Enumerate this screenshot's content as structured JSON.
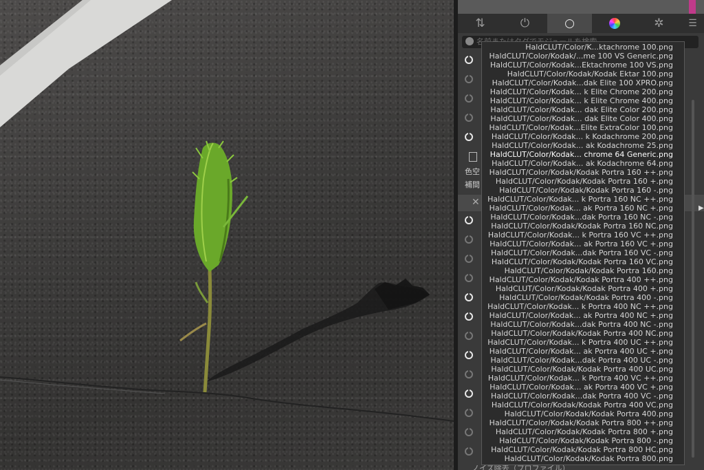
{
  "tabs": [
    {
      "name": "sliders-icon",
      "glyph": "⇅"
    },
    {
      "name": "power-icon",
      "glyph": "⏻"
    },
    {
      "name": "circle-icon",
      "glyph": "○"
    },
    {
      "name": "color-wheel-icon",
      "glyph": "●"
    },
    {
      "name": "presets-icon",
      "glyph": "✲"
    }
  ],
  "tab_menu_glyph": "☰",
  "search": {
    "placeholder": "名前またはタグでモジュールを検索"
  },
  "side_labels": [
    "色空",
    "補間"
  ],
  "bottom_text": "ノイズ除去（プロファイル）",
  "colors": {
    "panel_bg": "#3a3a3a",
    "dropdown_bg": "#2c2c2c",
    "selected_text": "#ffffff"
  },
  "lut_list": [
    "HaldCLUT/Color/K...ktachrome 100.png",
    "HaldCLUT/Color/Kodak/...me 100 VS Generic.png",
    "HaldCLUT/Color/Kodak...Ektachrome 100 VS.png",
    "HaldCLUT/Color/Kodak/Kodak Ektar 100.png",
    "HaldCLUT/Color/Kodak...dak Elite 100 XPRO.png",
    "HaldCLUT/Color/Kodak... k Elite Chrome 200.png",
    "HaldCLUT/Color/Kodak... k Elite Chrome 400.png",
    "HaldCLUT/Color/Kodak... dak Elite Color 200.png",
    "HaldCLUT/Color/Kodak... dak Elite Color 400.png",
    "HaldCLUT/Color/Kodak...Elite ExtraColor 100.png",
    "HaldCLUT/Color/Kodak... k Kodachrome 200.png",
    "HaldCLUT/Color/Kodak... ak Kodachrome 25.png",
    "HaldCLUT/Color/Kodak... chrome 64 Generic.png",
    "HaldCLUT/Color/Kodak... ak Kodachrome 64.png",
    "HaldCLUT/Color/Kodak/Kodak Portra 160 ++.png",
    "HaldCLUT/Color/Kodak/Kodak Portra 160 +.png",
    "HaldCLUT/Color/Kodak/Kodak Portra 160 -.png",
    "HaldCLUT/Color/Kodak... k Portra 160 NC ++.png",
    "HaldCLUT/Color/Kodak... ak Portra 160 NC +.png",
    "HaldCLUT/Color/Kodak...dak Portra 160 NC -.png",
    "HaldCLUT/Color/Kodak/Kodak Portra 160 NC.png",
    "HaldCLUT/Color/Kodak... k Portra 160 VC ++.png",
    "HaldCLUT/Color/Kodak... ak Portra 160 VC +.png",
    "HaldCLUT/Color/Kodak...dak Portra 160 VC -.png",
    "HaldCLUT/Color/Kodak/Kodak Portra 160 VC.png",
    "HaldCLUT/Color/Kodak/Kodak Portra 160.png",
    "HaldCLUT/Color/Kodak/Kodak Portra 400 ++.png",
    "HaldCLUT/Color/Kodak/Kodak Portra 400 +.png",
    "HaldCLUT/Color/Kodak/Kodak Portra 400 -.png",
    "HaldCLUT/Color/Kodak... k Portra 400 NC ++.png",
    "HaldCLUT/Color/Kodak... ak Portra 400 NC +.png",
    "HaldCLUT/Color/Kodak...dak Portra 400 NC -.png",
    "HaldCLUT/Color/Kodak/Kodak Portra 400 NC.png",
    "HaldCLUT/Color/Kodak... k Portra 400 UC ++.png",
    "HaldCLUT/Color/Kodak... ak Portra 400 UC +.png",
    "HaldCLUT/Color/Kodak...dak Portra 400 UC -.png",
    "HaldCLUT/Color/Kodak/Kodak Portra 400 UC.png",
    "HaldCLUT/Color/Kodak... k Portra 400 VC ++.png",
    "HaldCLUT/Color/Kodak... ak Portra 400 VC +.png",
    "HaldCLUT/Color/Kodak...dak Portra 400 VC -.png",
    "HaldCLUT/Color/Kodak/Kodak Portra 400 VC.png",
    "HaldCLUT/Color/Kodak/Kodak Portra 400.png",
    "HaldCLUT/Color/Kodak/Kodak Portra 800 ++.png",
    "HaldCLUT/Color/Kodak/Kodak Portra 800 +.png",
    "HaldCLUT/Color/Kodak/Kodak Portra 800 -.png",
    "HaldCLUT/Color/Kodak/Kodak Portra 800 HC.png",
    "HaldCLUT/Color/Kodak/Kodak Portra 800.png"
  ],
  "selected_index": 12
}
